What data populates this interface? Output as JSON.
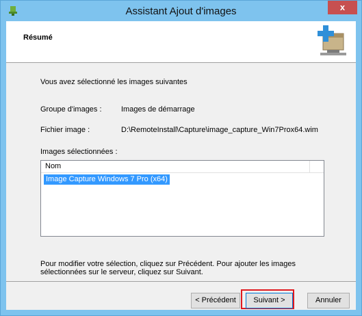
{
  "window": {
    "title": "Assistant Ajout d'images",
    "close_label": "x"
  },
  "header": {
    "title": "Résumé"
  },
  "content": {
    "intro": "Vous avez sélectionné les images suivantes",
    "group_label": "Groupe d'images :",
    "group_value": "Images de démarrage",
    "file_label": "Fichier image :",
    "file_value": "D:\\RemoteInstall\\Capture\\image_capture_Win7Prox64.wim",
    "selected_label": "Images sélectionnées :",
    "list": {
      "column": "Nom",
      "items": [
        "Image Capture Windows 7 Pro (x64)"
      ]
    },
    "hint": "Pour modifier votre sélection, cliquez sur Précédent. Pour ajouter les images sélectionnées sur le serveur, cliquez sur Suivant."
  },
  "buttons": {
    "prev": "< Précédent",
    "next": "Suivant >",
    "cancel": "Annuler"
  }
}
